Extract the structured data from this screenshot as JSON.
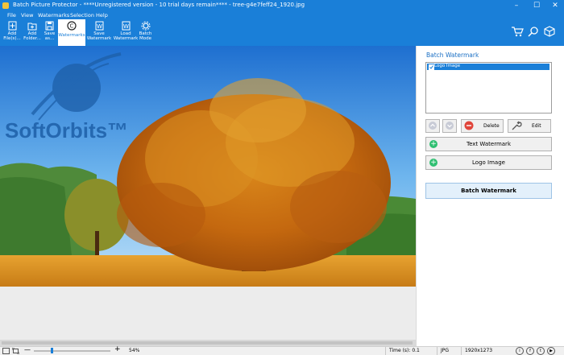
{
  "window": {
    "title": "Batch Picture Protector - ****Unregistered version - 10 trial days remain**** - tree-g4e7feff24_1920.jpg",
    "controls": [
      "–",
      "☐",
      "✕"
    ]
  },
  "menu": [
    "File",
    "View",
    "Watermarks",
    "Selection",
    "Help"
  ],
  "ribbon": {
    "add_files": "Add File(s)...",
    "add_folder": "Add Folder...",
    "save_as": "Save as...",
    "watermarks": "Watermarks",
    "save_watermark": "Save Watermark",
    "load_watermark": "Load Watermark",
    "batch_mode": "Batch Mode",
    "active": "watermarks"
  },
  "canvas": {
    "watermark_text": "SoftOrbits™"
  },
  "panel": {
    "title": "Batch Watermark",
    "list_items": [
      {
        "label": "Logo Image",
        "checked": true
      }
    ],
    "delete_label": "Delete",
    "edit_label": "Edit",
    "text_watermark_label": "Text Watermark",
    "logo_image_label": "Logo Image",
    "batch_watermark_label": "Batch Watermark"
  },
  "status": {
    "zoom": "54%",
    "time": "Time (s): 0.1",
    "format": "JPG",
    "dimensions": "1920x1273",
    "social": [
      "i",
      "f",
      "t",
      "▶"
    ]
  },
  "colors": {
    "accent": "#1a7fd8",
    "add_green": "#2fbf71",
    "delete_red": "#e0453a"
  }
}
